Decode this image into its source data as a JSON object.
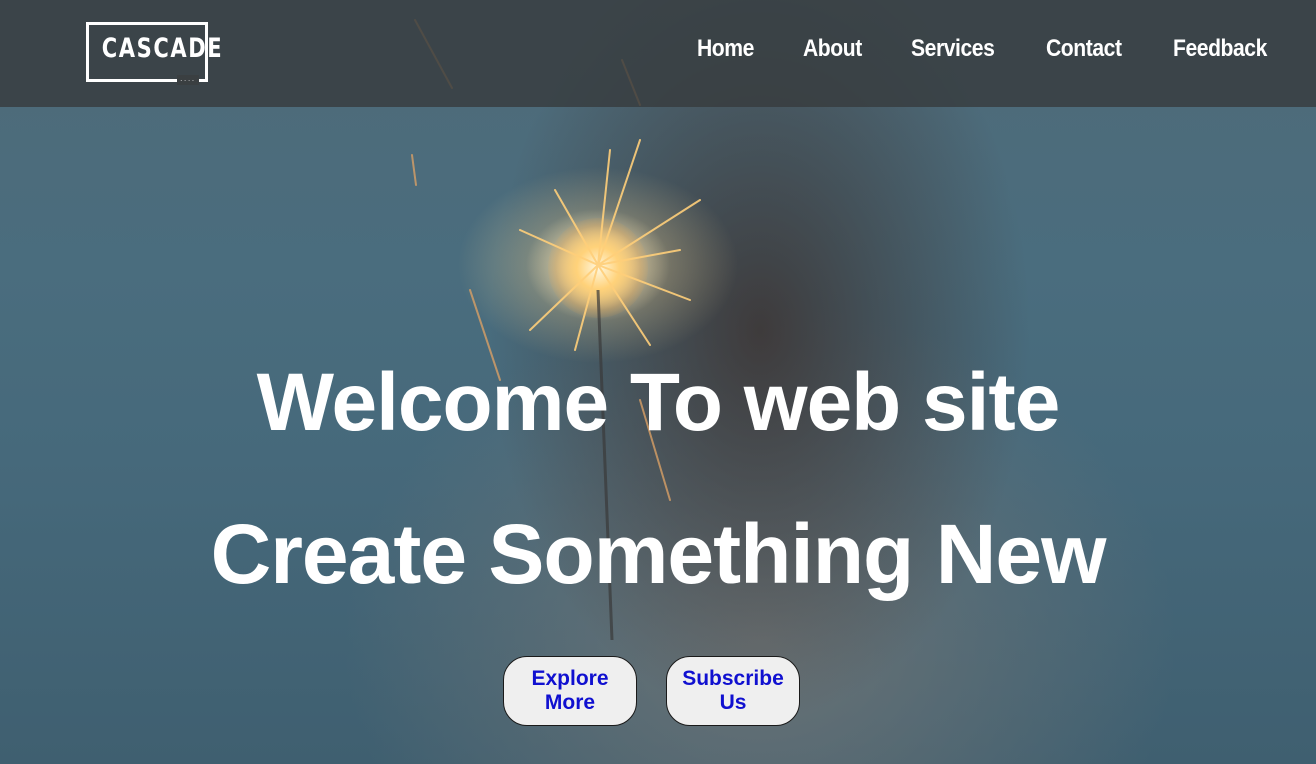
{
  "brand": {
    "logo_text": "CASCADE",
    "logo_sub": "...."
  },
  "nav": {
    "items": [
      {
        "label": "Home"
      },
      {
        "label": "About"
      },
      {
        "label": "Services"
      },
      {
        "label": "Contact"
      },
      {
        "label": "Feedback"
      }
    ]
  },
  "hero": {
    "headline_1": "Welcome To web site",
    "headline_2": "Create Something New",
    "primary_cta": "Explore More",
    "secondary_cta": "Subscribe Us",
    "image_subject": "sparkler-photo"
  },
  "colors": {
    "nav_text": "#ffffff",
    "headline_text": "#ffffff",
    "button_bg": "#efefef",
    "button_text": "#1010d0",
    "navbar_bg": "#373c3e"
  }
}
